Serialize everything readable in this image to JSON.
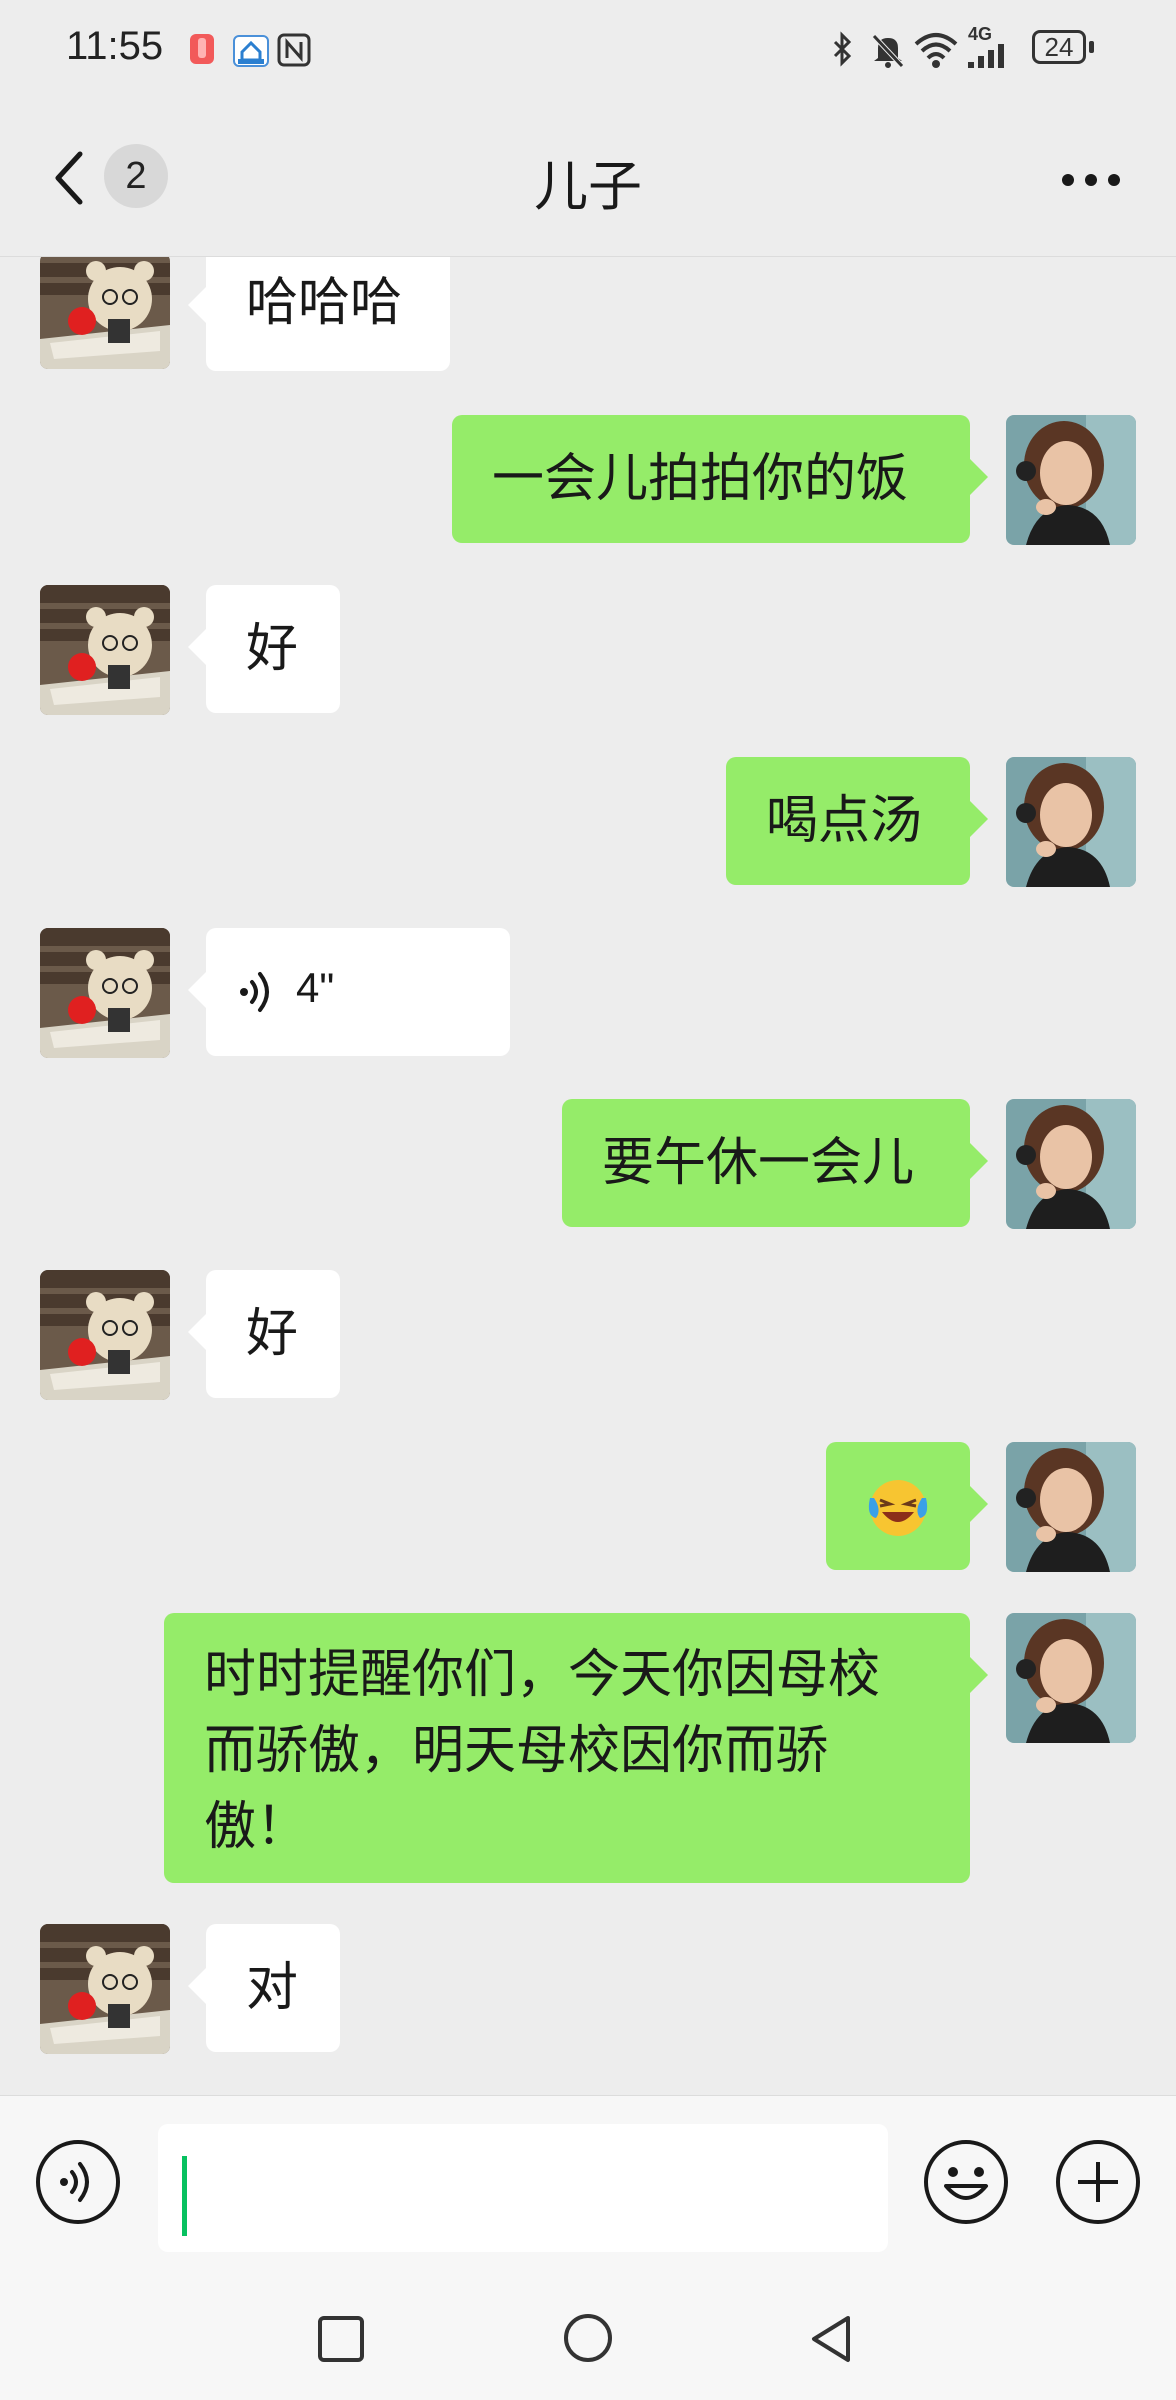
{
  "status_bar": {
    "time": "11:55",
    "network": "4G",
    "battery": "24",
    "icons": [
      "app-notification-icon",
      "home-app-icon",
      "nfc-icon",
      "bluetooth-icon",
      "mute-icon",
      "wifi-icon",
      "signal-icon",
      "battery-icon"
    ]
  },
  "nav": {
    "back_badge": "2",
    "title": "儿子",
    "more_icon": "more-icon"
  },
  "messages": [
    {
      "side": "in",
      "type": "text",
      "text": "哈哈哈"
    },
    {
      "side": "out",
      "type": "text",
      "text": "一会儿拍拍你的饭"
    },
    {
      "side": "in",
      "type": "text",
      "text": "好"
    },
    {
      "side": "out",
      "type": "text",
      "text": "喝点汤"
    },
    {
      "side": "in",
      "type": "voice",
      "text": "4\""
    },
    {
      "side": "out",
      "type": "text",
      "text": "要午休一会儿"
    },
    {
      "side": "in",
      "type": "text",
      "text": "好"
    },
    {
      "side": "out",
      "type": "emoji",
      "text": "laughing-crying-emoji"
    },
    {
      "side": "out",
      "type": "text",
      "lines": [
        "时时提醒你们，今天你因母校",
        "而骄傲，明天母校因你而骄",
        "傲！"
      ]
    },
    {
      "side": "in",
      "type": "text",
      "text": "对"
    }
  ],
  "input_bar": {
    "value": "",
    "voice_icon": "voice-input-icon",
    "emoji_icon": "emoji-icon",
    "plus_icon": "plus-icon"
  },
  "colors": {
    "background": "#ededed",
    "outgoing_bubble": "#95ec69",
    "incoming_bubble": "#ffffff",
    "caret": "#07c160"
  }
}
